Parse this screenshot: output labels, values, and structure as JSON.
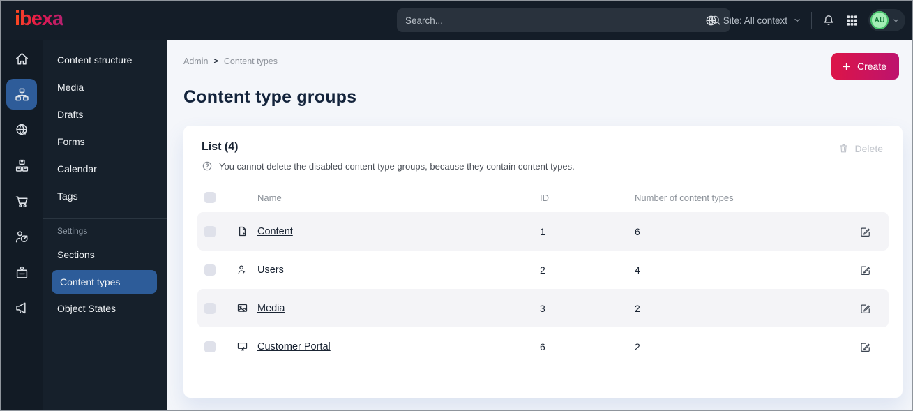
{
  "topbar": {
    "logo": "ibexa",
    "search_placeholder": "Search...",
    "site_context": "Site: All context",
    "avatar_initials": "AU",
    "icons": [
      "globe-icon",
      "bell-icon",
      "app-grid-icon",
      "search-icon"
    ]
  },
  "icon_rail": {
    "items": [
      "dashboard-home",
      "content-structure",
      "site",
      "product-catalog",
      "commerce",
      "customers",
      "company",
      "campaign"
    ],
    "selected": "content-structure",
    "selected_color": "#2e5c99"
  },
  "sidebar": {
    "items": [
      "Content structure",
      "Media",
      "Drafts",
      "Forms",
      "Calendar",
      "Tags"
    ],
    "settings_label": "Settings",
    "settings_items": [
      "Sections",
      "Content types",
      "Object States"
    ],
    "selected": "Content types",
    "selected_color": "#2d5c99"
  },
  "main": {
    "breadcrumb": {
      "items": [
        "Admin",
        "Content types"
      ],
      "separator": ">"
    },
    "create_label": "Create",
    "title": "Content type groups",
    "card": {
      "list_title": "List (4)",
      "info": "You cannot delete the disabled content type groups, because they contain content types.",
      "delete_label": "Delete",
      "table": {
        "columns": [
          "Name",
          "ID",
          "Number of content types"
        ],
        "rows": [
          {
            "icon": "content-file-icon",
            "name": "Content",
            "id": "1",
            "count": "6"
          },
          {
            "icon": "users-person-icon",
            "name": "Users",
            "id": "2",
            "count": "4"
          },
          {
            "icon": "media-image-icon",
            "name": "Media",
            "id": "3",
            "count": "2"
          },
          {
            "icon": "portal-monitor-icon",
            "name": "Customer Portal",
            "id": "6",
            "count": "2"
          }
        ]
      }
    }
  },
  "colors": {
    "topbar_bg": "#141d28",
    "accent_blue": "#2d5c99",
    "brand_gradient_start": "#dc1548",
    "brand_gradient_end": "#bd136e",
    "page_bg": "#f4f6fa",
    "avatar_green": "#49c46d"
  }
}
